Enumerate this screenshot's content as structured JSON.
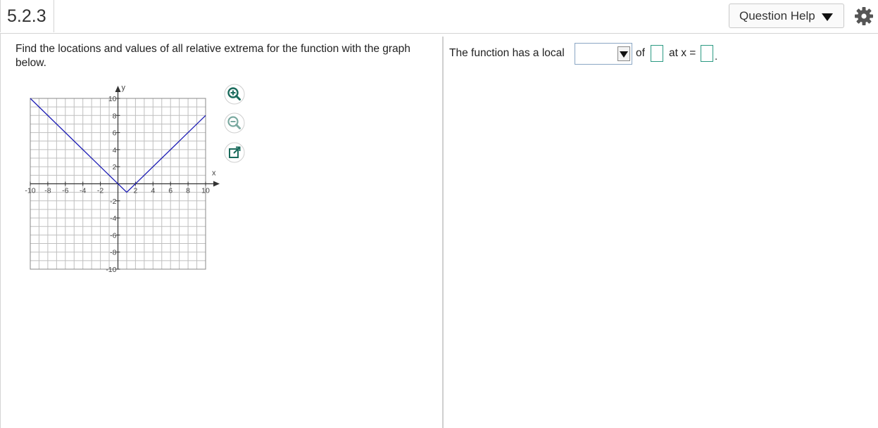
{
  "header": {
    "question_number": "5.2.3",
    "question_help_label": "Question Help"
  },
  "question": {
    "prompt": "Find the locations and values of all relative extrema for the function with the graph below."
  },
  "answer": {
    "text_prefix": "The function has a local",
    "select_value": "",
    "text_of": "of",
    "value_input": "",
    "text_at": "at x =",
    "x_input": "",
    "suffix": "."
  },
  "tools": [
    "zoom-in-icon",
    "zoom-out-icon",
    "popout-icon"
  ],
  "chart_data": {
    "type": "line",
    "xlabel": "x",
    "ylabel": "y",
    "xlim": [
      -10,
      10
    ],
    "ylim": [
      -10,
      10
    ],
    "grid": true,
    "x_ticks": [
      "-10",
      "-8",
      "-6",
      "-4",
      "-2",
      "2",
      "4",
      "6",
      "8",
      "10"
    ],
    "y_ticks": [
      "10",
      "8",
      "6",
      "4",
      "2",
      "-2",
      "-4",
      "-6",
      "-8",
      "-10"
    ],
    "series": [
      {
        "x": [
          -10,
          1,
          10
        ],
        "y": [
          10,
          -1,
          8
        ],
        "color": "#1d1db5"
      }
    ]
  },
  "colors": {
    "curve": "#1d1db5",
    "input_border": "#2b9a83",
    "grid": "#bfbfbf"
  }
}
